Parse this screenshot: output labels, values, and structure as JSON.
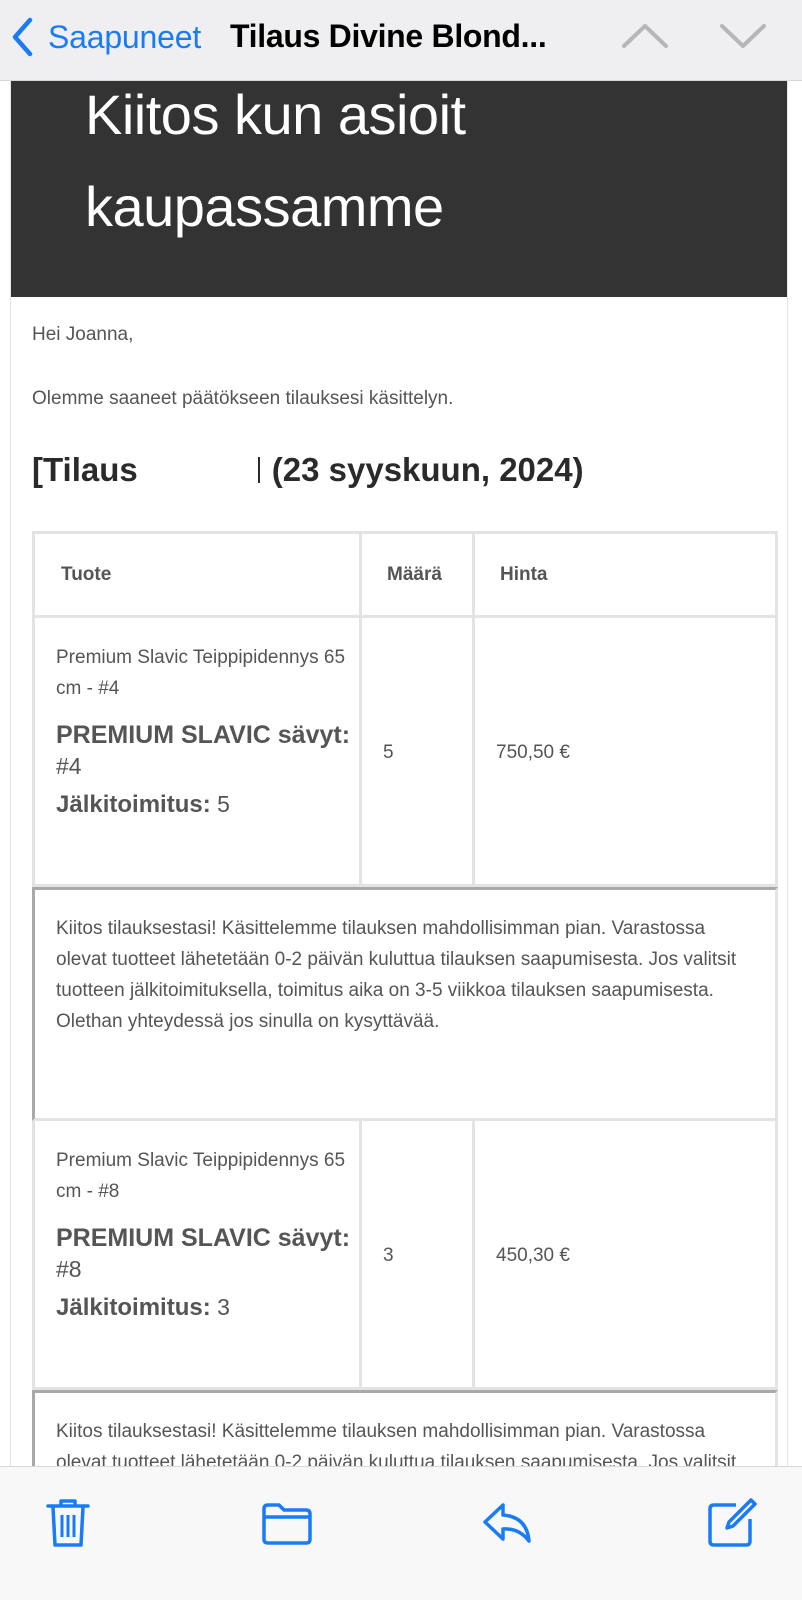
{
  "nav": {
    "back_label": "Saapuneet",
    "title": "Tilaus Divine Blond...",
    "icons": {
      "back": "chevron-left-icon",
      "previous": "chevron-up-icon",
      "next": "chevron-down-icon"
    },
    "accent_color": "#1a7cf5"
  },
  "email": {
    "hero_title": "Kiitos kun asioit kaupassamme",
    "hero_bg": "#333333",
    "greeting": "Hei Joanna,",
    "intro": "Olemme saaneet päätökseen tilauksesi käsittelyn.",
    "order_heading_start": "[Tilaus",
    "order_heading_date": "(23 syyskuun, 2024)",
    "table": {
      "headers": [
        "Tuote",
        "Määrä",
        "Hinta"
      ],
      "items": [
        {
          "name": "Premium Slavic Teippipidennys 65 cm - #4",
          "variant_label": "PREMIUM SLAVIC sävyt:",
          "shade": "#4",
          "backorder_label": "Jälkitoimitus:",
          "backorder_value": "5",
          "quantity": "5",
          "price": "750,50 €"
        },
        {
          "name": "Premium Slavic Teippipidennys 65 cm - #8",
          "variant_label": "PREMIUM SLAVIC sävyt:",
          "shade": "#8",
          "backorder_label": "Jälkitoimitus:",
          "backorder_value": "3",
          "quantity": "3",
          "price": "450,30 €"
        }
      ],
      "note": "Kiitos tilauksestasi! Käsittelemme tilauksen mahdollisimman pian. Varastossa olevat tuotteet lähetetään 0-2 päivän kuluttua tilauksen saapumisesta. Jos valitsit tuotteen jälkitoimituksella, toimitus aika on 3-5 viikkoa tilauksen saapumisesta. Olethan yhteydessä jos sinulla on kysyttävää."
    }
  },
  "toolbar": {
    "icons": [
      "trash-icon",
      "folder-icon",
      "reply-icon",
      "compose-icon"
    ]
  }
}
